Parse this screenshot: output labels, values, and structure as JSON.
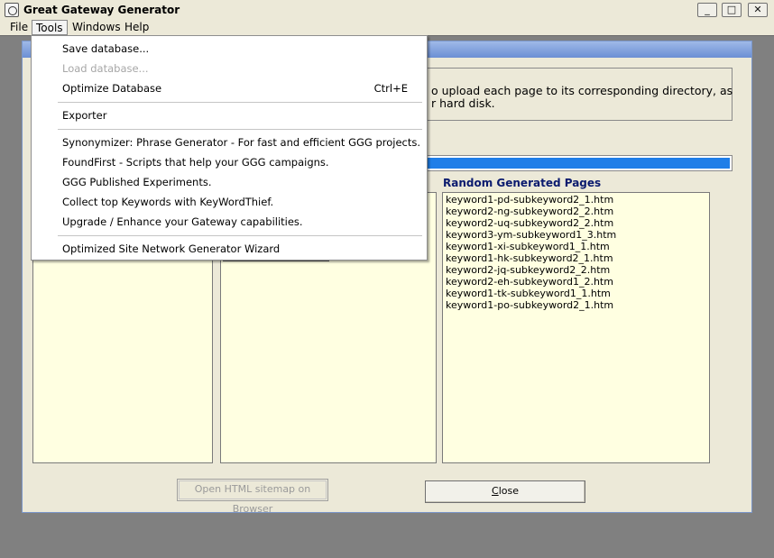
{
  "app": {
    "title": "Great Gateway Generator",
    "window_buttons": {
      "minimize": "_",
      "maximize": "□",
      "close": "✕"
    }
  },
  "menubar": {
    "file": "File",
    "tools": "Tools",
    "windows": "Windows",
    "help": "Help"
  },
  "tools_menu": {
    "save_database": "Save database...",
    "load_database": "Load database...",
    "optimize_database": "Optimize Database",
    "optimize_shortcut": "Ctrl+E",
    "exporter": "Exporter",
    "synonymizer": "Synonymizer: Phrase Generator - For fast and efficient GGG projects.",
    "foundfirst": "FoundFirst - Scripts that help your GGG campaigns.",
    "published_experiments": "GGG Published Experiments.",
    "keywordthief": "Collect top Keywords with KeyWordThief.",
    "upgrade": "Upgrade / Enhance your Gateway capabilities.",
    "site_network_wizard": "Optimized Site Network Generator Wizard"
  },
  "dialog": {
    "description_line1": "o upload each page to its corresponding directory, as",
    "description_line2": "r hard disk.",
    "progress_percent": 100,
    "random_pages_label": "Random Generated Pages",
    "random_pages": [
      "keyword1-pd-subkeyword2_1.htm",
      "keyword2-ng-subkeyword2_2.htm",
      "keyword2-uq-subkeyword2_2.htm",
      "keyword3-ym-subkeyword1_3.htm",
      "keyword1-xi-subkeyword1_1.htm",
      "keyword1-hk-subkeyword2_1.htm",
      "keyword2-jq-subkeyword2_2.htm",
      "keyword2-eh-subkeyword1_2.htm",
      "keyword1-tk-subkeyword1_1.htm",
      "keyword1-po-subkeyword2_1.htm"
    ],
    "sitemap_button": "Open HTML sitemap on Browser",
    "close_button_underlined": "C",
    "close_button_rest": "lose"
  }
}
